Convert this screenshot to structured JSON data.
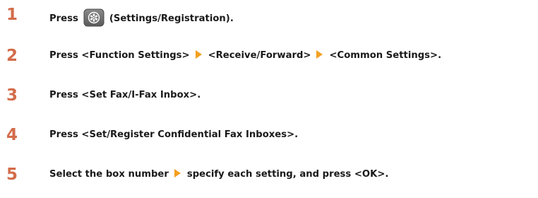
{
  "steps": [
    {
      "number": "1",
      "press": "Press",
      "icon": "settings-registration-icon",
      "after_icon": "(Settings/Registration)."
    },
    {
      "number": "2",
      "part1": "Press <Function Settings>",
      "part2": "<Receive/Forward>",
      "part3": "<Common Settings>."
    },
    {
      "number": "3",
      "text": "Press <Set Fax/I-Fax Inbox>."
    },
    {
      "number": "4",
      "text": "Press <Set/Register Confidential Fax Inboxes>."
    },
    {
      "number": "5",
      "part1": "Select the box number",
      "part2": "specify each setting, and press <OK>."
    }
  ],
  "colors": {
    "step_number": "#d36c4a",
    "arrow": "#f4a020",
    "text": "#1a1a1a",
    "icon_background": "#6b6b6b"
  }
}
